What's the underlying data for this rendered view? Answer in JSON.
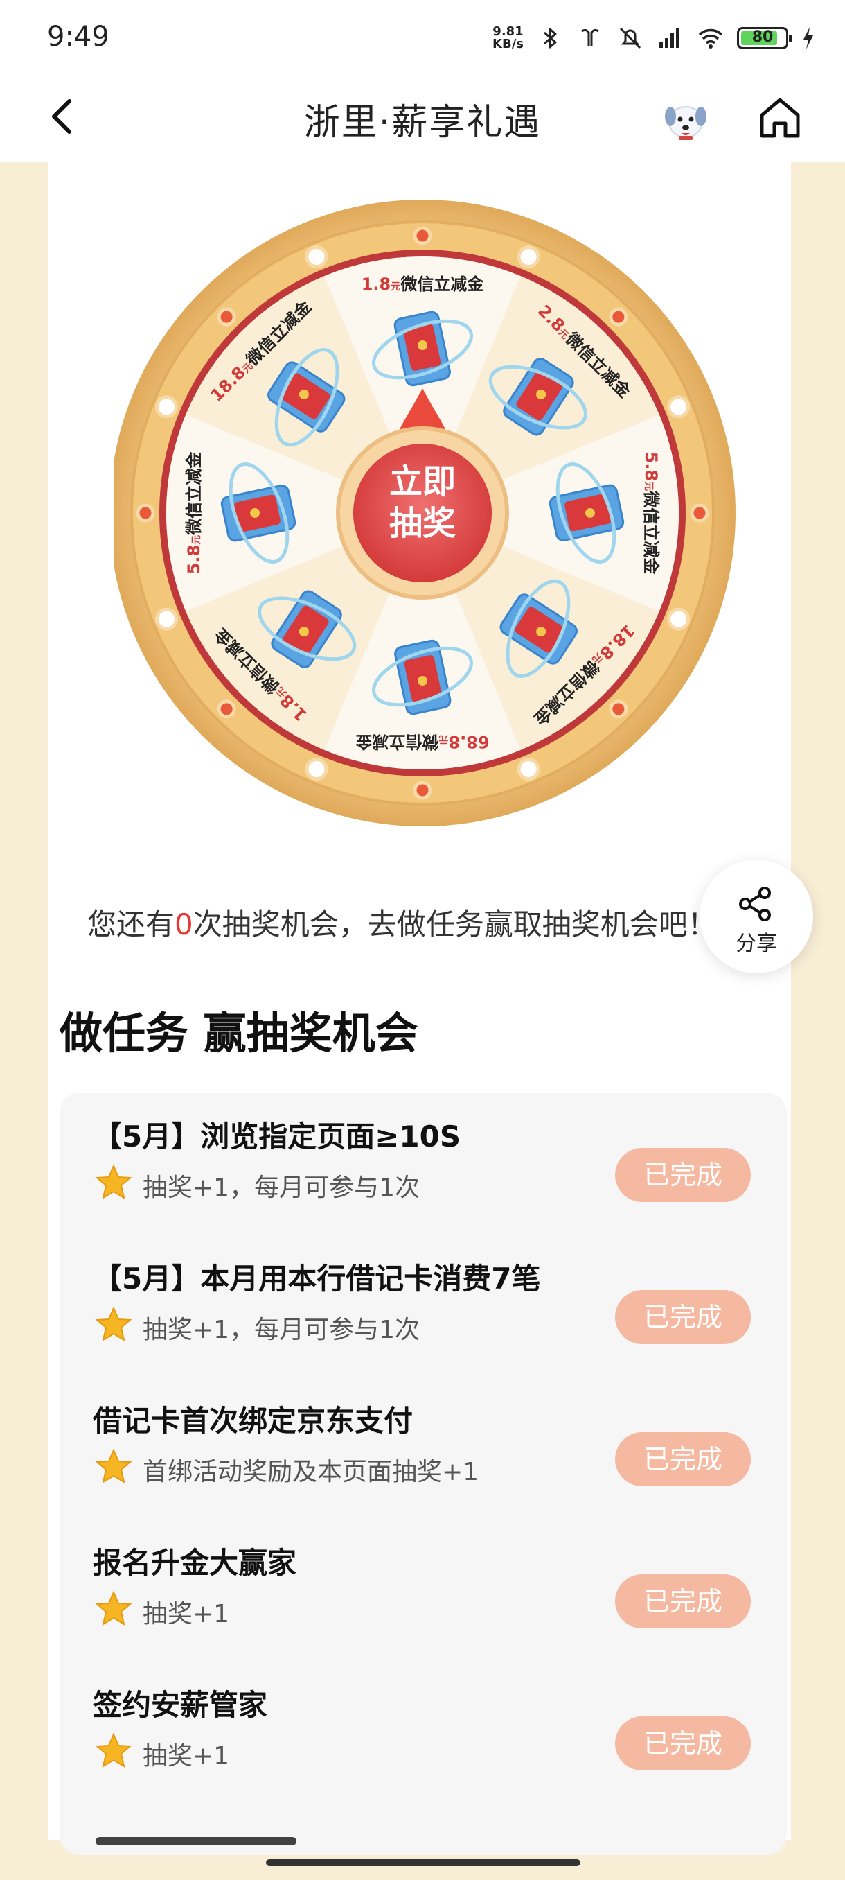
{
  "status_bar": {
    "time": "9:49",
    "net_speed_value": "9.81",
    "net_speed_unit": "KB/s",
    "battery": "80",
    "battery_level": 0.8
  },
  "header": {
    "title": "浙里·薪享礼遇",
    "back_icon": "chevron-left-icon",
    "home_icon": "home-icon"
  },
  "wheel": {
    "center_line1": "立即",
    "center_line2": "抽奖",
    "prizes": [
      {
        "amount": "1.8",
        "unit": "元",
        "label": "微信立减金"
      },
      {
        "amount": "2.8",
        "unit": "元",
        "label": "微信立减金"
      },
      {
        "amount": "5.8",
        "unit": "元",
        "label": "微信立减金"
      },
      {
        "amount": "18.8",
        "unit": "元",
        "label": "微信立减金"
      },
      {
        "amount": "68.8",
        "unit": "元",
        "label": "微信立减金"
      },
      {
        "amount": "1.8",
        "unit": "元",
        "label": "微信立减金"
      },
      {
        "amount": "5.8",
        "unit": "元",
        "label": "微信立减金"
      },
      {
        "amount": "18.8",
        "unit": "元",
        "label": "微信立减金"
      }
    ]
  },
  "chance": {
    "prefix": "您还有",
    "count": "0",
    "suffix": "次抽奖机会，去做任务赢取抽奖机会吧！"
  },
  "share": {
    "label": "分享",
    "icon": "share-icon"
  },
  "tasks_section": {
    "title": "做任务 赢抽奖机会",
    "items": [
      {
        "title": "【5月】浏览指定页面≥10S",
        "reward": "抽奖+1，每月可参与1次",
        "status": "已完成"
      },
      {
        "title": "【5月】本月用本行借记卡消费7笔",
        "reward": "抽奖+1，每月可参与1次",
        "status": "已完成"
      },
      {
        "title": "借记卡首次绑定京东支付",
        "reward": "首绑活动奖励及本页面抽奖+1",
        "status": "已完成"
      },
      {
        "title": "报名升金大赢家",
        "reward": "抽奖+1",
        "status": "已完成"
      },
      {
        "title": "签约安薪管家",
        "reward": "抽奖+1",
        "status": "已完成"
      }
    ]
  },
  "colors": {
    "accent_red": "#e53935",
    "done_button": "#f5b8a1",
    "wheel_gold": "#e9b668",
    "page_bg": "#f8edd5"
  }
}
